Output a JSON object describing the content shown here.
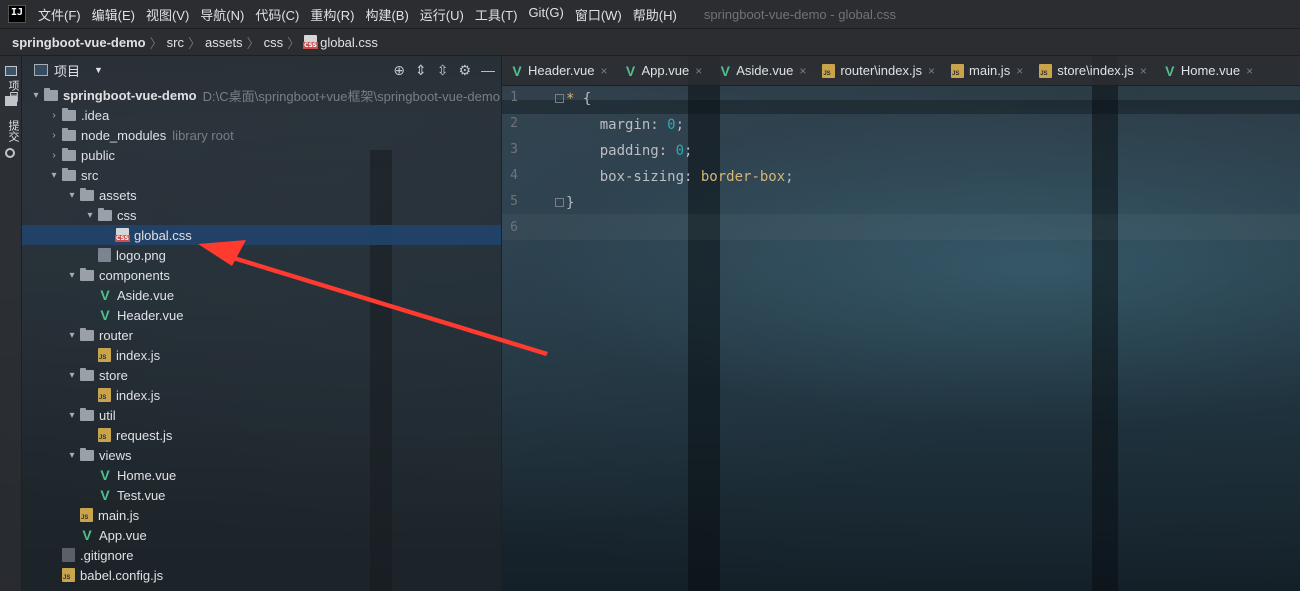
{
  "window_title": "springboot-vue-demo - global.css",
  "menu": [
    "文件(F)",
    "编辑(E)",
    "视图(V)",
    "导航(N)",
    "代码(C)",
    "重构(R)",
    "构建(B)",
    "运行(U)",
    "工具(T)",
    "Git(G)",
    "窗口(W)",
    "帮助(H)"
  ],
  "logo_text": "IJ",
  "breadcrumb": [
    "springboot-vue-demo",
    "src",
    "assets",
    "css",
    "global.css"
  ],
  "toolstrip": {
    "project_label": "项目",
    "commit_label": "提交"
  },
  "project_panel": {
    "title": "项目",
    "tree": [
      {
        "indent": 0,
        "arrow": "▾",
        "icon": "folder",
        "label": "springboot-vue-demo",
        "hint": "D:\\C桌面\\springboot+vue框架\\springboot-vue-demo",
        "bold": true
      },
      {
        "indent": 1,
        "arrow": "›",
        "icon": "folder",
        "label": ".idea"
      },
      {
        "indent": 1,
        "arrow": "›",
        "icon": "folder",
        "label": "node_modules",
        "hint": "library root"
      },
      {
        "indent": 1,
        "arrow": "›",
        "icon": "folder",
        "label": "public"
      },
      {
        "indent": 1,
        "arrow": "▾",
        "icon": "folder",
        "label": "src"
      },
      {
        "indent": 2,
        "arrow": "▾",
        "icon": "folder",
        "label": "assets"
      },
      {
        "indent": 3,
        "arrow": "▾",
        "icon": "folder",
        "label": "css"
      },
      {
        "indent": 4,
        "arrow": "",
        "icon": "css",
        "label": "global.css",
        "selected": true
      },
      {
        "indent": 3,
        "arrow": "",
        "icon": "png",
        "label": "logo.png"
      },
      {
        "indent": 2,
        "arrow": "▾",
        "icon": "folder",
        "label": "components"
      },
      {
        "indent": 3,
        "arrow": "",
        "icon": "vue",
        "label": "Aside.vue"
      },
      {
        "indent": 3,
        "arrow": "",
        "icon": "vue",
        "label": "Header.vue"
      },
      {
        "indent": 2,
        "arrow": "▾",
        "icon": "folder",
        "label": "router"
      },
      {
        "indent": 3,
        "arrow": "",
        "icon": "js",
        "label": "index.js"
      },
      {
        "indent": 2,
        "arrow": "▾",
        "icon": "folder",
        "label": "store"
      },
      {
        "indent": 3,
        "arrow": "",
        "icon": "js",
        "label": "index.js"
      },
      {
        "indent": 2,
        "arrow": "▾",
        "icon": "folder",
        "label": "util"
      },
      {
        "indent": 3,
        "arrow": "",
        "icon": "js",
        "label": "request.js"
      },
      {
        "indent": 2,
        "arrow": "▾",
        "icon": "folder",
        "label": "views"
      },
      {
        "indent": 3,
        "arrow": "",
        "icon": "vue",
        "label": "Home.vue"
      },
      {
        "indent": 3,
        "arrow": "",
        "icon": "vue",
        "label": "Test.vue"
      },
      {
        "indent": 2,
        "arrow": "",
        "icon": "js",
        "label": "main.js"
      },
      {
        "indent": 2,
        "arrow": "",
        "icon": "vue",
        "label": "App.vue"
      },
      {
        "indent": 1,
        "arrow": "",
        "icon": "git",
        "label": ".gitignore"
      },
      {
        "indent": 1,
        "arrow": "",
        "icon": "js",
        "label": "babel.config.js"
      }
    ]
  },
  "tabs": [
    {
      "icon": "vue",
      "label": "Header.vue"
    },
    {
      "icon": "vue",
      "label": "App.vue"
    },
    {
      "icon": "vue",
      "label": "Aside.vue"
    },
    {
      "icon": "js",
      "label": "router\\index.js"
    },
    {
      "icon": "js",
      "label": "main.js"
    },
    {
      "icon": "js",
      "label": "store\\index.js"
    },
    {
      "icon": "vue",
      "label": "Home.vue"
    }
  ],
  "editor": {
    "line_numbers": [
      "1",
      "2",
      "3",
      "4",
      "5",
      "6"
    ],
    "lines": [
      {
        "indent": "",
        "tokens": [
          {
            "t": "*",
            "c": "sel-star"
          },
          {
            "t": " {",
            "c": "punct"
          }
        ]
      },
      {
        "indent": "    ",
        "tokens": [
          {
            "t": "margin",
            "c": "prop"
          },
          {
            "t": ": ",
            "c": "punct"
          },
          {
            "t": "0",
            "c": "num"
          },
          {
            "t": ";",
            "c": "punct"
          }
        ]
      },
      {
        "indent": "    ",
        "tokens": [
          {
            "t": "padding",
            "c": "prop"
          },
          {
            "t": ": ",
            "c": "punct"
          },
          {
            "t": "0",
            "c": "num"
          },
          {
            "t": ";",
            "c": "punct"
          }
        ]
      },
      {
        "indent": "    ",
        "tokens": [
          {
            "t": "box-sizing",
            "c": "prop"
          },
          {
            "t": ": ",
            "c": "punct"
          },
          {
            "t": "border-box",
            "c": "val"
          },
          {
            "t": ";",
            "c": "punct"
          }
        ]
      },
      {
        "indent": "",
        "tokens": [
          {
            "t": "}",
            "c": "punct"
          }
        ]
      },
      {
        "indent": "",
        "tokens": []
      }
    ]
  },
  "annotation": {
    "color": "#ff3b2f",
    "shape": "arrow pointing at global.css"
  }
}
